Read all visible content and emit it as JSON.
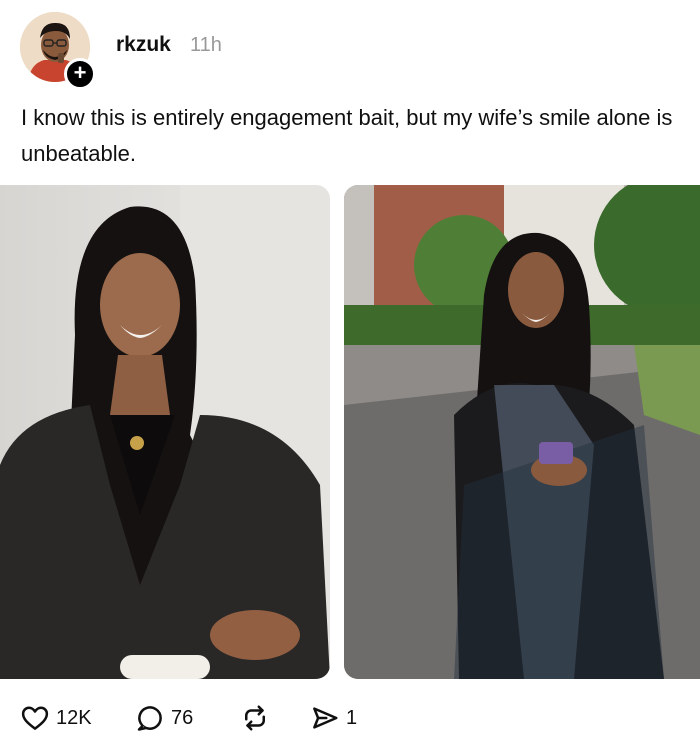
{
  "post": {
    "username": "rkzuk",
    "time": "11h",
    "text": "I know this is entirely engagement bait, but my wife’s smile alone is unbeatable."
  },
  "actions": {
    "likes": "12K",
    "replies": "76",
    "shares": "1"
  },
  "icons": {
    "follow": "plus-icon",
    "like": "heart-icon",
    "reply": "comment-icon",
    "repost": "repost-icon",
    "share": "send-icon"
  },
  "colors": {
    "text": "#101010",
    "muted": "#999999",
    "badge": "#000000"
  }
}
